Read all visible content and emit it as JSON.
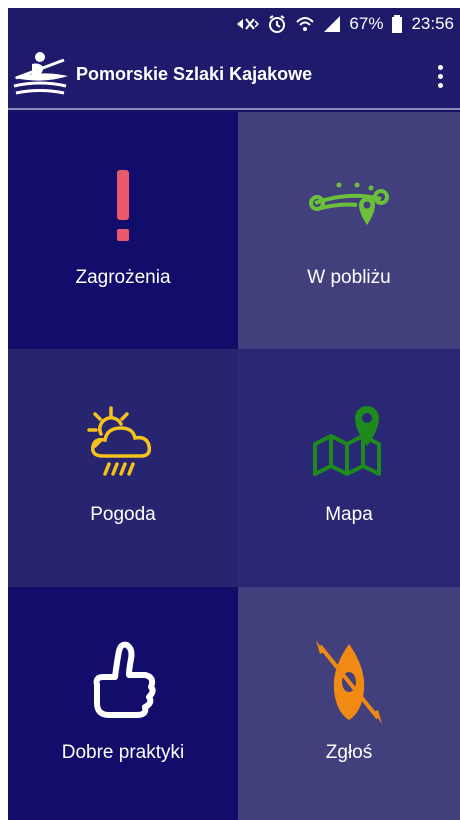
{
  "status_bar": {
    "battery": "67%",
    "time": "23:56",
    "icons": [
      "mute-icon",
      "alarm-icon",
      "wifi-icon",
      "signal-icon",
      "battery-icon"
    ]
  },
  "app_bar": {
    "title": "Pomorskie Szlaki Kajakowe",
    "logo": "kayak-logo",
    "menu_icon": "overflow-menu-icon"
  },
  "tiles": [
    {
      "label": "Zagrożenia",
      "icon": "exclamation-icon",
      "color": "#e85a6a"
    },
    {
      "label": "W pobliżu",
      "icon": "route-pins-icon",
      "color": "#6cbf3a"
    },
    {
      "label": "Pogoda",
      "icon": "weather-icon",
      "color": "#f4c21b"
    },
    {
      "label": "Mapa",
      "icon": "map-pin-icon",
      "color": "#1e8a1e"
    },
    {
      "label": "Dobre praktyki",
      "icon": "thumbs-up-icon",
      "color": "#ffffff"
    },
    {
      "label": "Zgłoś",
      "icon": "kayak-icon",
      "color": "#f08a12"
    }
  ],
  "colors": {
    "background": "#1a1466",
    "tile_dark": "#120d6b",
    "tile_light": "#42407c"
  }
}
